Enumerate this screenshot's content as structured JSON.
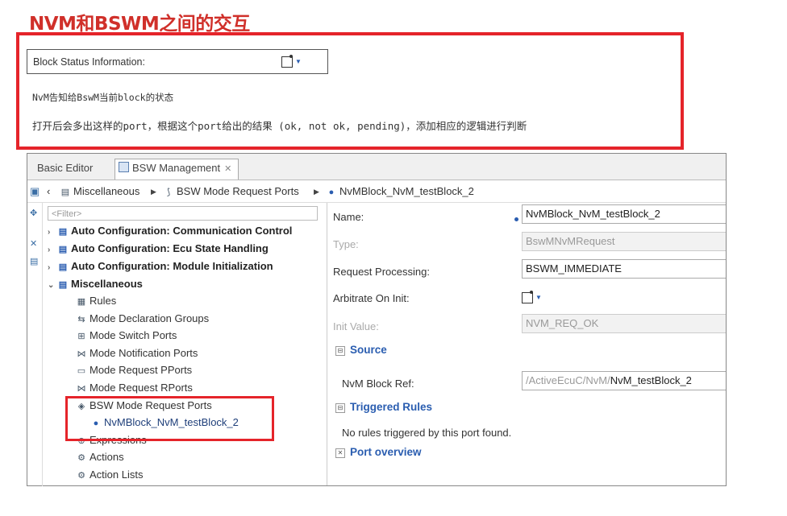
{
  "slide": {
    "title": "NVM和BSWM之间的交互",
    "status_label": "Block Status Information:",
    "note1": "NvM告知给BswM当前block的状态",
    "note2": "打开后会多出这样的port，根据这个port给出的结果 (ok, not ok, pending)，添加相应的逻辑进行判断"
  },
  "tabs": {
    "basic_editor": "Basic Editor",
    "bsw_management": "BSW Management",
    "close_glyph": "✕"
  },
  "breadcrumb": {
    "item1": "Miscellaneous",
    "item2": "BSW Mode Request Ports",
    "item3": "NvMBlock_NvM_testBlock_2"
  },
  "tree": {
    "filter_placeholder": "<Filter>",
    "nodes": [
      {
        "label": "Auto Configuration: Communication Control",
        "arrow": "›",
        "icon": "▤"
      },
      {
        "label": "Auto Configuration: Ecu State Handling",
        "arrow": "›",
        "icon": "▤"
      },
      {
        "label": "Auto Configuration: Module Initialization",
        "arrow": "›",
        "icon": "▤"
      },
      {
        "label": "Miscellaneous",
        "arrow": "⌄",
        "icon": "▤"
      },
      {
        "label": "Rules",
        "icon": "▦"
      },
      {
        "label": "Mode Declaration Groups",
        "icon": "⇆"
      },
      {
        "label": "Mode Switch Ports",
        "icon": "⊞"
      },
      {
        "label": "Mode Notification Ports",
        "icon": "⋈"
      },
      {
        "label": "Mode Request PPorts",
        "icon": "▭"
      },
      {
        "label": "Mode Request RPorts",
        "icon": "⋈"
      },
      {
        "label": "BSW Mode Request Ports",
        "icon": "◈"
      },
      {
        "label": "NvMBlock_NvM_testBlock_2",
        "icon": "●"
      },
      {
        "label": "Expressions",
        "icon": "⊕"
      },
      {
        "label": "Actions",
        "icon": "⚙"
      },
      {
        "label": "Action Lists",
        "icon": "⚙"
      }
    ]
  },
  "props": {
    "name_label": "Name:",
    "name_value": "NvMBlock_NvM_testBlock_2",
    "type_label": "Type:",
    "type_value": "BswMNvMRequest",
    "processing_label": "Request Processing:",
    "processing_value": "BSWM_IMMEDIATE",
    "arbitrate_label": "Arbitrate On Init:",
    "init_label": "Init Value:",
    "init_value": "NVM_REQ_OK",
    "source_section": "Source",
    "ref_label": "NvM Block Ref:",
    "ref_prefix": "/ActiveEcuC/NvM/",
    "ref_value": "NvM_testBlock_2",
    "triggered_section": "Triggered Rules",
    "no_rules": "No rules triggered by this port found.",
    "port_overview_section": "Port overview"
  },
  "colors": {
    "highlight_red": "#e5242a",
    "title_red": "#d0302a",
    "link_blue": "#2a5db0"
  }
}
